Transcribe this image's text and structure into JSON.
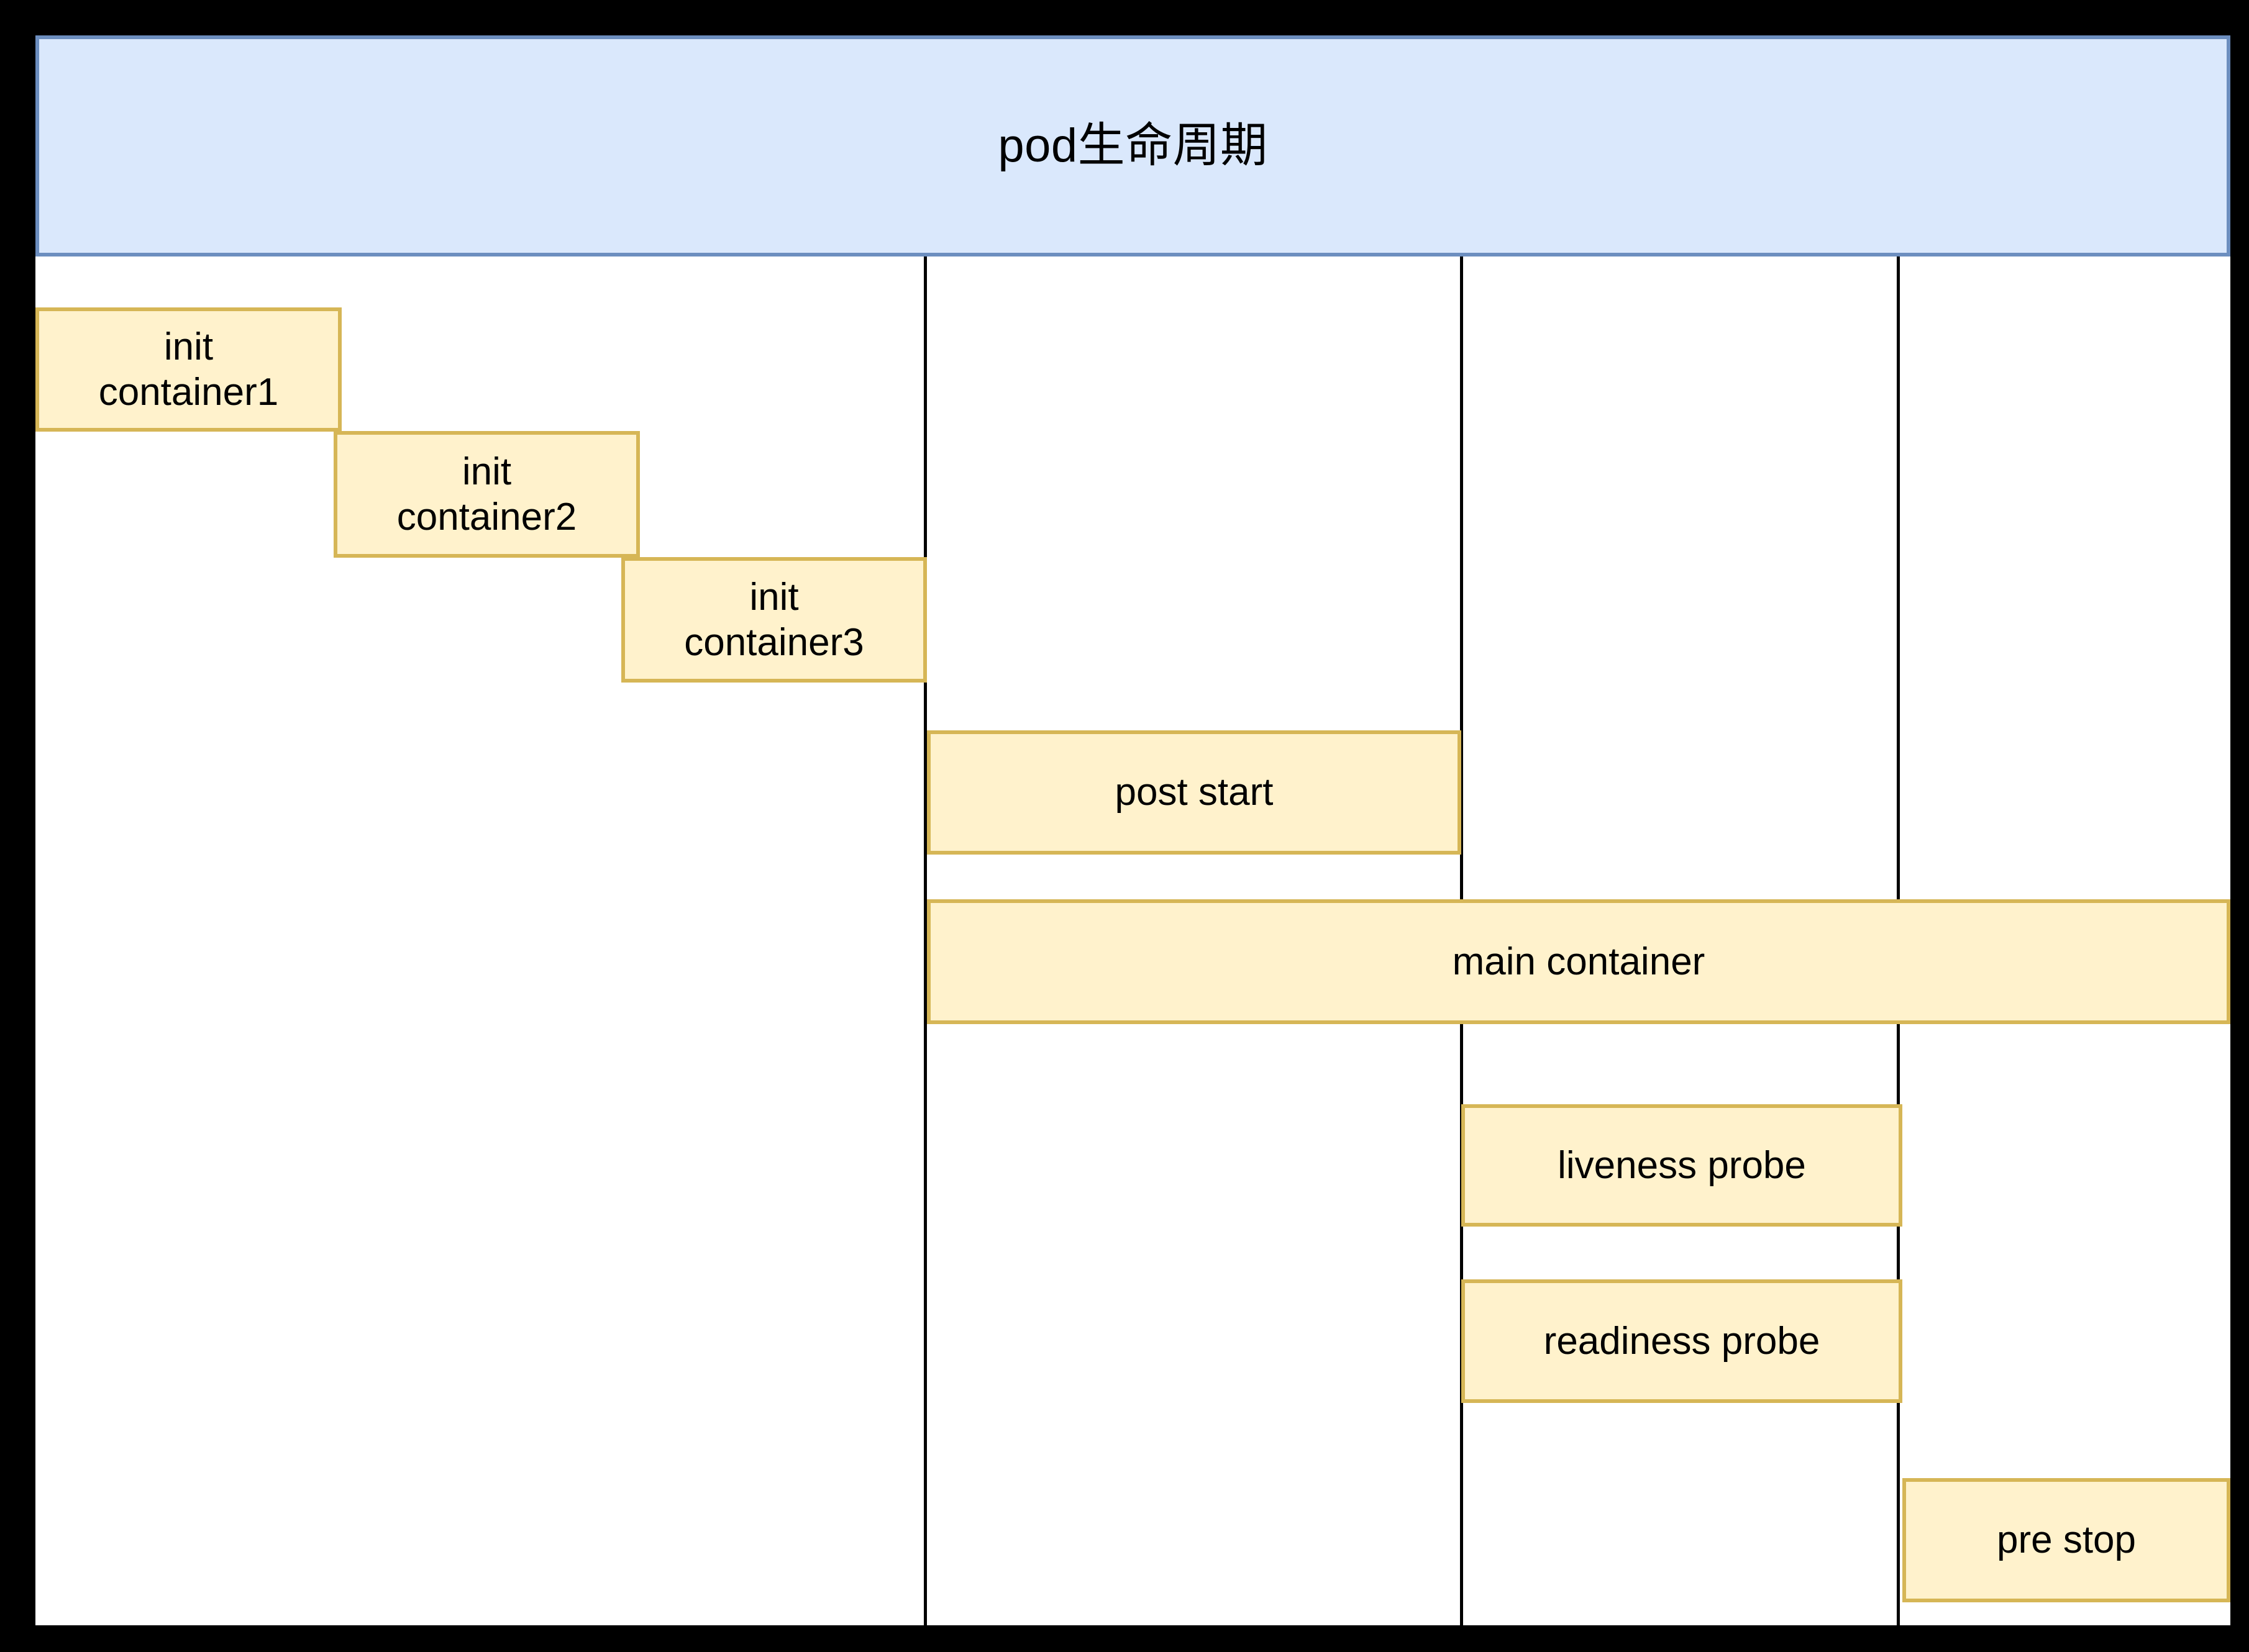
{
  "diagram": {
    "title": "pod生命周期",
    "title_colors": {
      "fill": "#dae8fc",
      "stroke": "#6c8ebf",
      "text": "#000000"
    },
    "box_colors": {
      "fill": "#fff2cc",
      "stroke": "#d6b656",
      "text": "#000000"
    },
    "canvas_background": "#ffffff",
    "page_background": "#000000",
    "lane_divider_color": "#000000",
    "lanes": [
      {
        "name": "init-phase-lane"
      },
      {
        "name": "post-start-lane"
      },
      {
        "name": "probe-lane"
      },
      {
        "name": "pre-stop-lane"
      }
    ],
    "boxes": [
      {
        "id": "init-container1",
        "label": "init\ncontainer1"
      },
      {
        "id": "init-container2",
        "label": "init\ncontainer2"
      },
      {
        "id": "init-container3",
        "label": "init\ncontainer3"
      },
      {
        "id": "post-start",
        "label": "post start"
      },
      {
        "id": "main-container",
        "label": "main container"
      },
      {
        "id": "liveness-probe",
        "label": "liveness probe"
      },
      {
        "id": "readiness-probe",
        "label": "readiness probe"
      },
      {
        "id": "pre-stop",
        "label": "pre stop"
      }
    ]
  }
}
